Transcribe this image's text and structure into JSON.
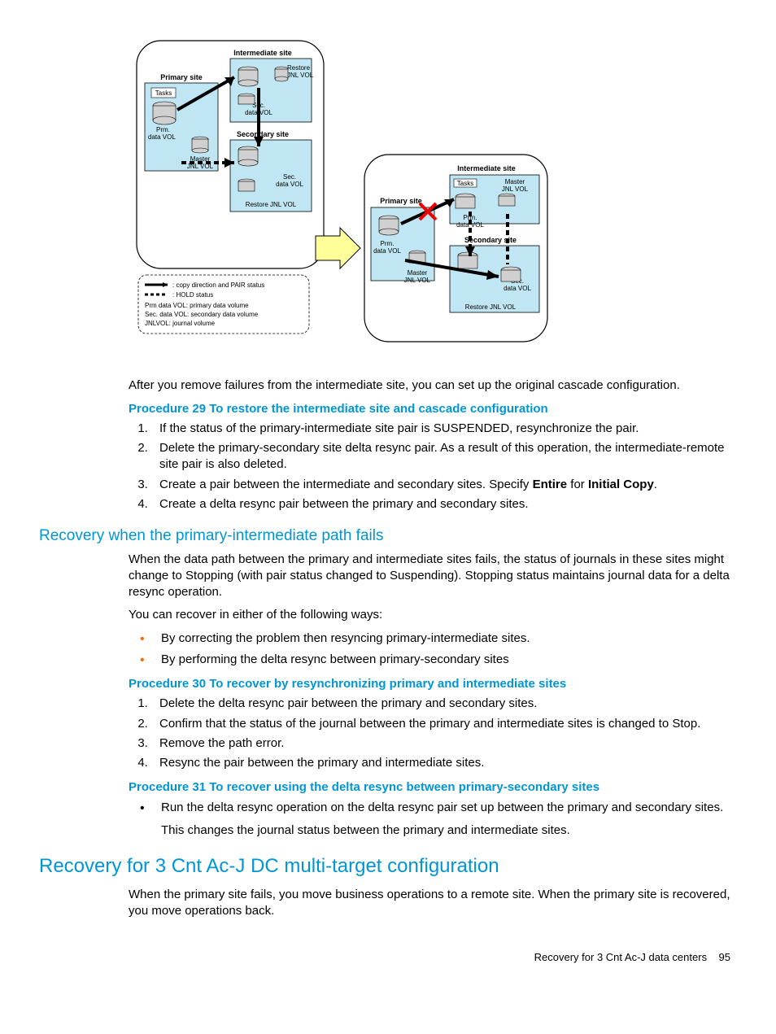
{
  "diagram": {
    "labels": {
      "primary1": "Primary site",
      "intermediate1": "Intermediate site",
      "secondary1": "Secondary site",
      "primary2": "Primary site",
      "intermediate2": "Intermediate site",
      "secondary2": "Secondary site",
      "tasks": "Tasks",
      "prm_data": "Prm.\ndata VOL",
      "master_jnl": "Master\nJNL VOL",
      "restore_jnl": "Restore\nJNL VOL",
      "sec_data": "Sec.\ndata VOL",
      "legend_arrow": ": copy direction and PAIR status",
      "legend_dash": ": HOLD status",
      "legend_prm": "Prm data VOL: primary data volume",
      "legend_sec": "Sec. data VOL: secondary data volume",
      "legend_jnl": "JNLVOL: journal volume"
    }
  },
  "para1": "After you remove failures from the intermediate site, you can set up the original cascade configuration.",
  "proc29_title": "Procedure 29 To restore the intermediate site and cascade configuration",
  "proc29": [
    "If the status of the primary-intermediate site pair is SUSPENDED, resynchronize the pair.",
    "Delete the primary-secondary site delta resync pair. As a result of this operation, the intermediate-remote site pair is also deleted.",
    "Create a pair between the intermediate and secondary sites. Specify <b>Entire</b> for <b>Initial Copy</b>.",
    "Create a delta resync pair between the primary and secondary sites."
  ],
  "h3_pathfail": "Recovery when the primary-intermediate path fails",
  "pathfail_p1": "When the data path between the primary and intermediate sites fails, the status of journals in these sites might change to Stopping (with pair status changed to Suspending). Stopping status maintains journal data for a delta resync operation.",
  "pathfail_p2": "You can recover in either of the following ways:",
  "pathfail_bullets": [
    "By correcting the problem then resyncing primary-intermediate sites.",
    "By performing the delta resync between primary-secondary sites"
  ],
  "proc30_title": "Procedure 30 To recover by resynchronizing primary and intermediate sites",
  "proc30": [
    "Delete the delta resync pair between the primary and secondary sites.",
    "Confirm that the status of the journal between the primary and intermediate sites is changed to Stop.",
    "Remove the path error.",
    "Resync the pair between the primary and intermediate sites."
  ],
  "proc31_title": "Procedure 31 To recover using the delta resync between primary-secondary sites",
  "proc31_bullet": "Run the delta resync operation on the delta resync pair set up between the primary and secondary sites.",
  "proc31_sub": "This changes the journal status between the primary and intermediate sites.",
  "h2_multi": "Recovery for 3 Cnt Ac-J DC multi-target configuration",
  "multi_p1": "When the primary site fails, you move business operations to a remote site. When the primary site is recovered, you move operations back.",
  "footer_text": "Recovery for 3 Cnt Ac-J data centers",
  "footer_page": "95"
}
